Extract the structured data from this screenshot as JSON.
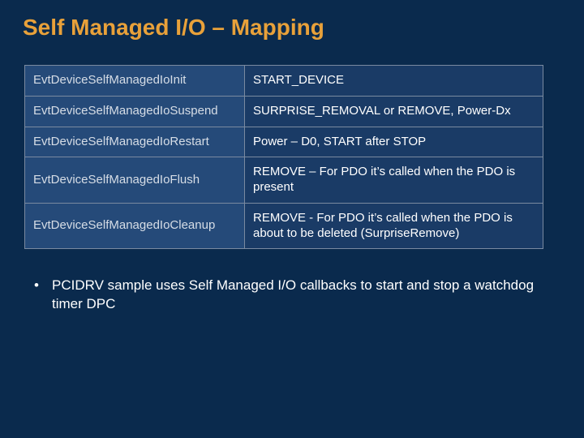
{
  "title": "Self Managed I/O – Mapping",
  "rows": [
    {
      "callback": "EvtDeviceSelfManagedIoInit",
      "mapping": "START_DEVICE"
    },
    {
      "callback": "EvtDeviceSelfManagedIoSuspend",
      "mapping": "SURPRISE_REMOVAL or REMOVE, Power-Dx"
    },
    {
      "callback": "EvtDeviceSelfManagedIoRestart",
      "mapping": "Power – D0, START after STOP"
    },
    {
      "callback": "EvtDeviceSelfManagedIoFlush",
      "mapping": "REMOVE – For PDO it’s called when the PDO is  present"
    },
    {
      "callback": "EvtDeviceSelfManagedIoCleanup",
      "mapping": "REMOVE -  For PDO it’s called when the PDO is about to be deleted (SurpriseRemove)"
    }
  ],
  "bullets": [
    "PCIDRV sample uses Self Managed I/O callbacks to start and stop a watchdog timer DPC"
  ]
}
